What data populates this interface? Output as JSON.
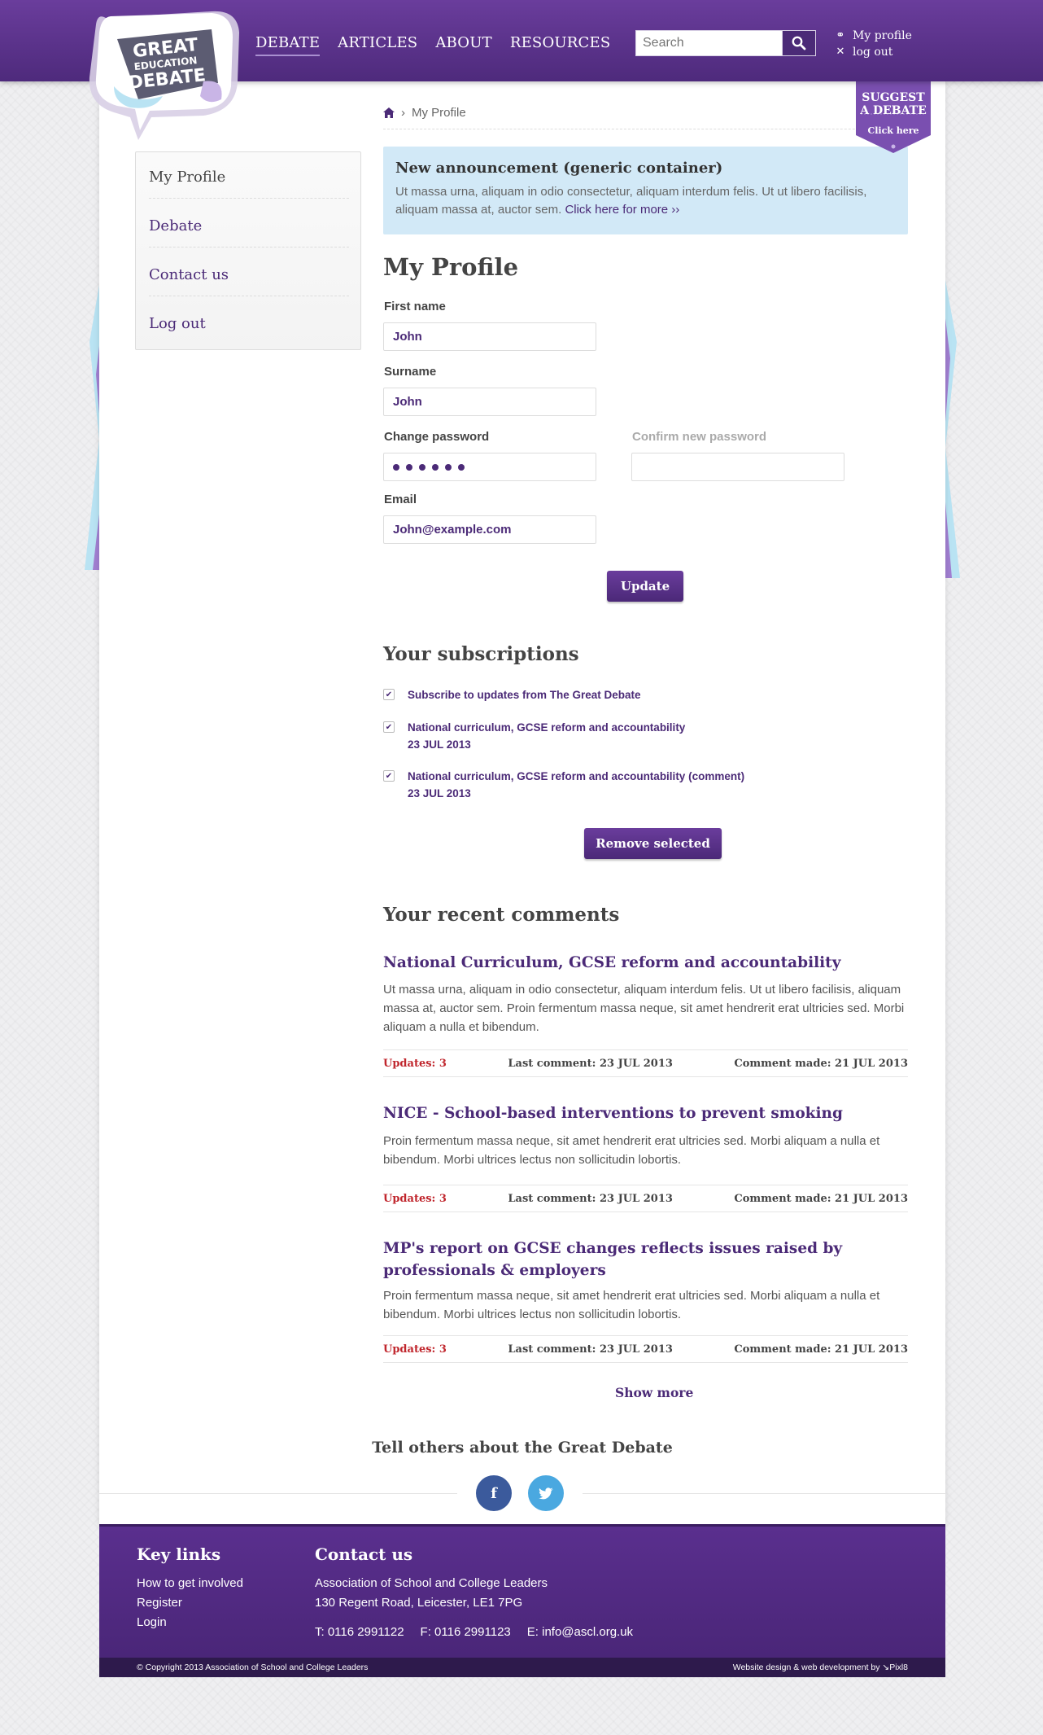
{
  "header": {
    "logo_text": [
      "GREAT",
      "EDUCATION",
      "DEBATE"
    ],
    "nav": [
      {
        "label": "DEBATE",
        "active": true
      },
      {
        "label": "ARTICLES",
        "active": false
      },
      {
        "label": "ABOUT",
        "active": false
      },
      {
        "label": "RESOURCES",
        "active": false
      }
    ],
    "search_placeholder": "Search",
    "user_links": {
      "profile": "My profile",
      "logout": "log out"
    }
  },
  "suggest": {
    "title_line1": "SUGGEST",
    "title_line2": "A DEBATE",
    "cta": "Click here"
  },
  "breadcrumb": {
    "current": "My Profile"
  },
  "sidebar": {
    "items": [
      {
        "label": "My Profile",
        "current": true
      },
      {
        "label": "Debate",
        "current": false
      },
      {
        "label": "Contact us",
        "current": false
      },
      {
        "label": "Log out",
        "current": false
      }
    ]
  },
  "announcement": {
    "title": "New announcement (generic container)",
    "body": "Ut massa urna, aliquam in odio consectetur, aliquam interdum felis. Ut ut libero facilisis, aliquam massa at, auctor sem.",
    "link": "Click here for more ››"
  },
  "profile": {
    "title": "My Profile",
    "first_name_label": "First name",
    "first_name_value": "John",
    "surname_label": "Surname",
    "surname_value": "John",
    "password_label": "Change password",
    "confirm_label": "Confirm new password",
    "email_label": "Email",
    "email_value": "John@example.com",
    "update_button": "Update"
  },
  "subscriptions": {
    "title": "Your subscriptions",
    "items": [
      {
        "label": "Subscribe to updates from The Great Debate",
        "date": ""
      },
      {
        "label": "National curriculum, GCSE reform and accountability",
        "date": "23 JUL 2013"
      },
      {
        "label": "National curriculum, GCSE reform and accountability (comment)",
        "date": "23 JUL 2013"
      }
    ],
    "remove_button": "Remove selected"
  },
  "comments": {
    "title": "Your recent comments",
    "items": [
      {
        "title": "National Curriculum, GCSE reform and accountability",
        "body": "Ut massa urna, aliquam in odio consectetur, aliquam interdum felis. Ut ut libero facilisis, aliquam massa at, auctor sem. Proin fermentum massa neque, sit amet hendrerit erat ultricies sed. Morbi aliquam a nulla et bibendum.",
        "updates": "Updates: 3",
        "last": "Last comment: 23 JUL 2013",
        "made": "Comment made: 21 JUL 2013"
      },
      {
        "title": "NICE - School-based interventions to prevent smoking",
        "body": "Proin fermentum massa neque, sit amet hendrerit erat ultricies sed. Morbi aliquam a nulla et bibendum. Morbi ultrices lectus non sollicitudin lobortis.",
        "updates": "Updates: 3",
        "last": "Last comment: 23 JUL 2013",
        "made": "Comment made: 21 JUL 2013"
      },
      {
        "title": "MP's report on GCSE changes reflects issues raised by professionals & employers",
        "body": "Proin fermentum massa neque, sit amet hendrerit erat ultricies sed. Morbi aliquam a nulla et bibendum. Morbi ultrices lectus non sollicitudin lobortis.",
        "updates": "Updates: 3",
        "last": "Last comment: 23 JUL 2013",
        "made": "Comment made: 21 JUL 2013"
      }
    ],
    "show_more": "Show more"
  },
  "share": {
    "title": "Tell others about the Great Debate",
    "facebook_icon": "f"
  },
  "footer": {
    "key_links_title": "Key links",
    "key_links": [
      "How to get involved",
      "Register",
      "Login"
    ],
    "contact_title": "Contact us",
    "contact_lines": [
      "Association of School and College Leaders",
      "130 Regent Road, Leicester, LE1 7PG"
    ],
    "phone": "T: 0116 2991122",
    "fax": "F: 0116 2991123",
    "email": "E: info@ascl.org.uk",
    "copyright": "© Copyright 2013 Association of School and College Leaders",
    "credit": "Website design & web development by",
    "credit_brand": "Pixl8"
  },
  "colors": {
    "primary": "#4b2a77",
    "accent_red": "#c0262d",
    "announce_bg": "#d2e9f7"
  }
}
